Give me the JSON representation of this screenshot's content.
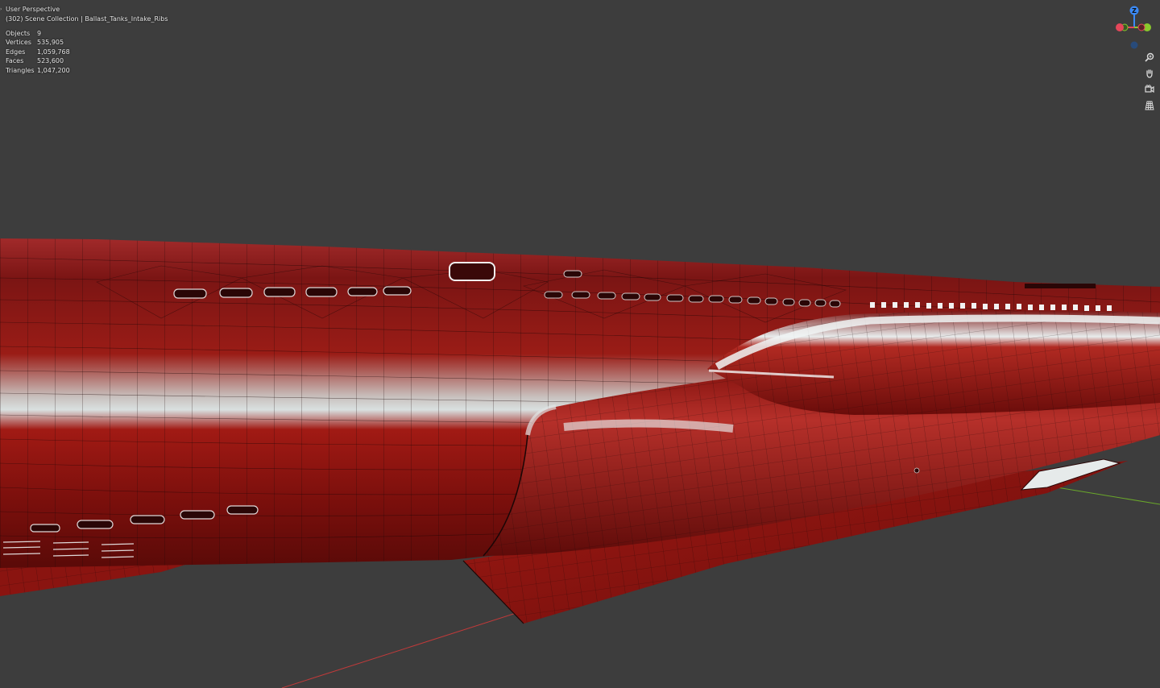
{
  "viewport": {
    "view_name": "User Perspective",
    "collection_path": "(302) Scene Collection | Ballast_Tanks_Intake_Ribs"
  },
  "stats": [
    {
      "label": "Objects",
      "value": "9"
    },
    {
      "label": "Vertices",
      "value": "535,905"
    },
    {
      "label": "Edges",
      "value": "1,059,768"
    },
    {
      "label": "Faces",
      "value": "523,600"
    },
    {
      "label": "Triangles",
      "value": "1,047,200"
    }
  ],
  "gizmo": {
    "z_label": "Z",
    "x_color": "#e5475a",
    "y_color": "#8ac82c",
    "z_color": "#3b8af5"
  },
  "nav_icons": [
    {
      "name": "zoom-icon",
      "glyph": "⌕"
    },
    {
      "name": "pan-hand-icon",
      "glyph": "✋"
    },
    {
      "name": "camera-icon",
      "glyph": "⎙"
    },
    {
      "name": "grid-icon",
      "glyph": "▦"
    }
  ],
  "colors": {
    "background": "#3d3d3d",
    "hull": "#8a1512",
    "hull_highlight": "#d9dede",
    "wire": "#1a0606"
  }
}
